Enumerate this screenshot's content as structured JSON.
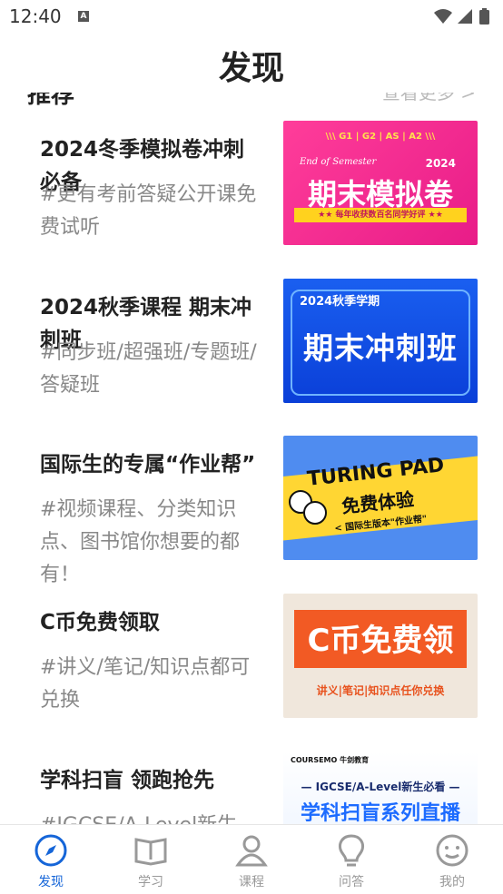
{
  "status_bar": {
    "time": "12:40",
    "notification_icon": "A"
  },
  "header": {
    "title": "发现"
  },
  "section": {
    "title": "推荐",
    "more": "查看更多 >"
  },
  "cards": [
    {
      "title": "2024冬季模拟卷冲刺必备",
      "desc": "#更有考前答疑公开课免费试听",
      "thumb": {
        "grades": "\\\\\\  G1 | G2 | AS | A2  \\\\\\",
        "eos": "End of Semester",
        "year": "2024",
        "big": "期末模拟卷",
        "strip": "★★ 每年收获数百名同学好评 ★★"
      }
    },
    {
      "title": "2024秋季课程 期末冲刺班",
      "desc": "#同步班/超强班/专题班/答疑班",
      "thumb": {
        "tag": "2024秋季学期",
        "big": "期末冲刺班"
      }
    },
    {
      "title": "国际生的专属“作业帮”",
      "desc": "#视频课程、分类知识点、图书馆你想要的都有！",
      "thumb": {
        "line1": "TURING PAD",
        "line2": "免费体验",
        "line3": "< 国际生版本\"作业帮\""
      }
    },
    {
      "title": "C币免费领取",
      "desc": "#讲义/笔记/知识点都可兑换",
      "thumb": {
        "big": "C币免费领",
        "sub": "讲义|笔记|知识点任你兑换"
      }
    },
    {
      "title": "学科扫盲 领跑抢先",
      "desc": "#IGCSE/A-Level新生",
      "thumb": {
        "brand": "COURSEMO 牛剑教育",
        "line": "— IGCSE/A-Level新生必看 —",
        "big": "学科扫盲系列直播"
      }
    }
  ],
  "nav": [
    {
      "label": "发现",
      "icon": "compass-icon",
      "active": true
    },
    {
      "label": "学习",
      "icon": "book-icon",
      "active": false
    },
    {
      "label": "课程",
      "icon": "person-icon",
      "active": false
    },
    {
      "label": "问答",
      "icon": "lightbulb-icon",
      "active": false
    },
    {
      "label": "我的",
      "icon": "smiley-icon",
      "active": false
    }
  ],
  "colors": {
    "accent": "#1565d8",
    "inactive": "#999999"
  }
}
